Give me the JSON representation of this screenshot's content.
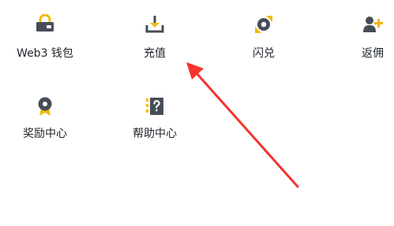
{
  "menu": {
    "items": [
      {
        "label": "Web3 钱包",
        "icon": "wallet-icon"
      },
      {
        "label": "充值",
        "icon": "download-icon"
      },
      {
        "label": "闪兑",
        "icon": "convert-icon"
      },
      {
        "label": "返佣",
        "icon": "add-user-icon"
      },
      {
        "label": "奖励中心",
        "icon": "reward-badge-icon"
      },
      {
        "label": "帮助中心",
        "icon": "help-icon"
      }
    ]
  },
  "colors": {
    "icon_dark": "#474d57",
    "accent": "#f0b90b",
    "annotation_arrow": "#f5332d"
  }
}
